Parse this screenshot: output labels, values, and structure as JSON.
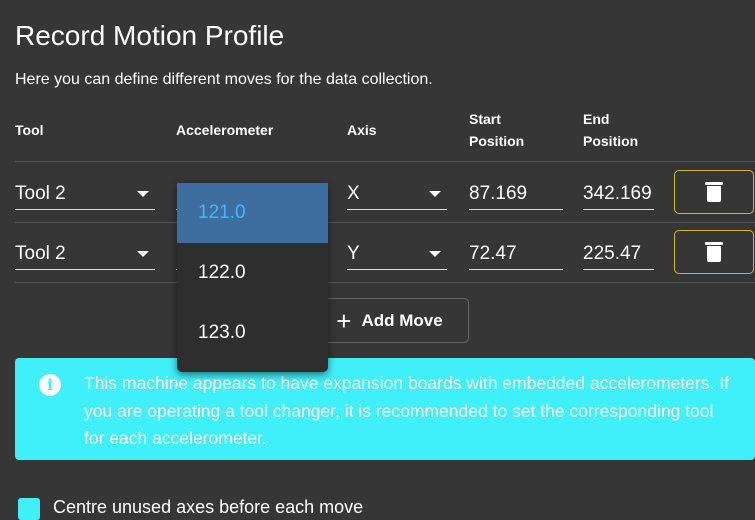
{
  "title": "Record Motion Profile",
  "subtitle": "Here you can define different moves for the data collection.",
  "headers": {
    "tool": "Tool",
    "accelerometer": "Accelerometer",
    "axis": "Axis",
    "start_line1": "Start",
    "start_line2": "Position",
    "end_line1": "End",
    "end_line2": "Position"
  },
  "rows": [
    {
      "tool": "Tool 2",
      "axis": "X",
      "start": "87.169",
      "end": "342.169"
    },
    {
      "tool": "Tool 2",
      "axis": "Y",
      "start": "72.47",
      "end": "225.47"
    }
  ],
  "accelerometer_menu": {
    "options": [
      "121.0",
      "122.0",
      "123.0"
    ],
    "selected": "121.0"
  },
  "add_move_label": "Add Move",
  "alert_text": "This machine appears to have expansion boards with embedded accelerometers. If you are operating a tool changer, it is recommended to set the corresponding tool for each accelerometer.",
  "checkbox": {
    "label": "Centre unused axes before each move",
    "checked": true
  },
  "colors": {
    "background": "#363636",
    "alert": "#3ff0fb",
    "menu_highlight": "#3e6ea0",
    "delete_border": "#d4b62a"
  }
}
